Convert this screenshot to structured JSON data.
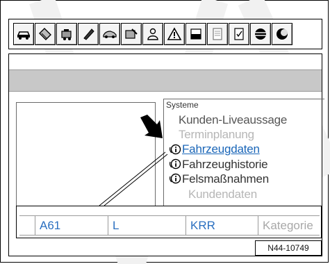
{
  "toolbar": {
    "buttons": [
      {
        "icon": "car-icon"
      },
      {
        "icon": "tag-icon"
      },
      {
        "icon": "engine-icon"
      },
      {
        "icon": "brush-icon"
      },
      {
        "icon": "vehicle-side-icon"
      },
      {
        "icon": "diagnosis-icon"
      },
      {
        "icon": "person-icon"
      },
      {
        "icon": "warning-icon"
      },
      {
        "icon": "gauge-icon"
      },
      {
        "icon": "document-icon"
      },
      {
        "icon": "checklist-icon"
      },
      {
        "icon": "globe-icon"
      },
      {
        "icon": "moon-icon"
      }
    ]
  },
  "systeme": {
    "legend": "Systeme",
    "items": [
      {
        "label": "Kunden-Liveaussage",
        "state": "normal"
      },
      {
        "label": "Terminplanung",
        "state": "disabled"
      },
      {
        "label": "Fahrzeugdaten",
        "state": "selected"
      },
      {
        "label": "Fahrzeughistorie",
        "state": "normal"
      },
      {
        "label": "Felsmaßnahmen",
        "state": "normal"
      },
      {
        "label": "Kundendaten",
        "state": "disabled"
      }
    ]
  },
  "datarow": {
    "cells": [
      "A61",
      "L",
      "KRR",
      "Kategorie"
    ]
  },
  "reference": "N44-10749"
}
